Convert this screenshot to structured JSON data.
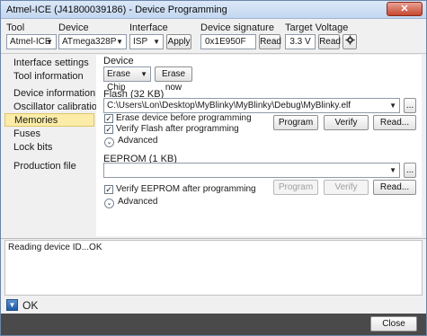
{
  "window": {
    "title": "Atmel-ICE (J41800039186) - Device Programming",
    "close_glyph": "✕"
  },
  "toolbar": {
    "tool_label": "Tool",
    "tool_value": "Atmel-ICE",
    "device_label": "Device",
    "device_value": "ATmega328P",
    "interface_label": "Interface",
    "interface_value": "ISP",
    "apply_label": "Apply",
    "signature_label": "Device signature",
    "signature_value": "0x1E950F",
    "signature_read": "Read",
    "voltage_label": "Target Voltage",
    "voltage_value": "3.3 V",
    "voltage_read": "Read",
    "settings_icon": "gear-icon"
  },
  "sidebar": {
    "items": [
      {
        "label": "Interface settings"
      },
      {
        "label": "Tool information"
      },
      {
        "label": "Device information"
      },
      {
        "label": "Oscillator calibration"
      },
      {
        "label": "Memories"
      },
      {
        "label": "Fuses"
      },
      {
        "label": "Lock bits"
      },
      {
        "label": "Production file"
      }
    ],
    "selected": "Memories"
  },
  "memories": {
    "device_heading": "Device",
    "erase_select": "Erase Chip",
    "erase_now": "Erase now",
    "flash_heading": "Flash (32 KB)",
    "flash_path": "C:\\Users\\Lon\\Desktop\\MyBlinky\\MyBlinky\\Debug\\MyBlinky.elf",
    "browse": "...",
    "erase_before": "Erase device before programming",
    "verify_flash": "Verify Flash after programming",
    "program": "Program",
    "verify": "Verify",
    "read": "Read...",
    "advanced": "Advanced",
    "eeprom_heading": "EEPROM (1 KB)",
    "eeprom_path": "",
    "verify_eeprom": "Verify EEPROM after programming",
    "advanced2": "Advanced"
  },
  "log": {
    "message": "Reading device ID...OK"
  },
  "output": {
    "label": "OK"
  },
  "footer": {
    "close_label": "Close"
  },
  "colors": {
    "selected_bg": "#fbeca7",
    "title_bar": "#c4d7ef",
    "footer_bar": "#4a4a4a"
  }
}
